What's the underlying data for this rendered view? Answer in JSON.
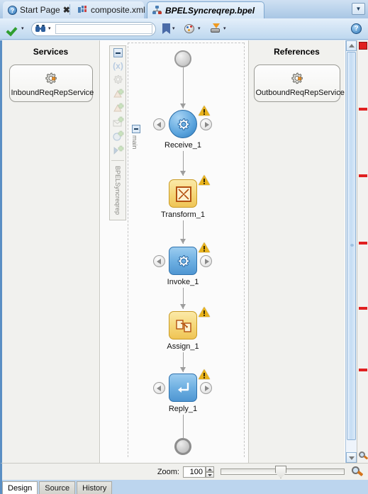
{
  "window": {
    "tabs": [
      {
        "label": "Start Page",
        "icon": "help-circle-icon",
        "active": false,
        "closable": true
      },
      {
        "label": "composite.xml",
        "icon": "composite-icon",
        "active": false,
        "closable": false
      },
      {
        "label": "BPELSyncreqrep.bpel",
        "icon": "bpel-icon",
        "active": true,
        "closable": false
      }
    ],
    "tab_overflow_label": "▼"
  },
  "toolbar": {
    "validate_label": "",
    "search_value": "",
    "search_placeholder": "",
    "bookmark_label": "",
    "palette_label": "",
    "deploy_label": "",
    "help_label": "?",
    "dropdown_caret": "▾"
  },
  "services_panel": {
    "title": "Services",
    "nodes": [
      {
        "label": "InboundReqRepService",
        "icon": "gear-icon"
      }
    ]
  },
  "references_panel": {
    "title": "References",
    "nodes": [
      {
        "label": "OutboundReqRepService",
        "icon": "gear-icon"
      }
    ]
  },
  "canvas": {
    "scope_label": "main",
    "palette_label": "BPELSyncreqrep",
    "palette_icons": [
      "variables-x-icon",
      "gear-icon",
      "partnerlink-add-icon",
      "partnerlink-add-2-icon",
      "message-add-icon",
      "scope-add-icon",
      "flag-add-icon"
    ],
    "start_node": {
      "name": "start-event"
    },
    "end_node": {
      "name": "end-event"
    },
    "nodes": [
      {
        "label": "Receive_1",
        "shape": "circle",
        "glyph": "gear-icon",
        "warning": true,
        "nav": true
      },
      {
        "label": "Transform_1",
        "shape": "sq-yellow",
        "glyph": "transform-icon",
        "warning": true,
        "nav": false
      },
      {
        "label": "Invoke_1",
        "shape": "sq-blue",
        "glyph": "gear-icon",
        "warning": true,
        "nav": true
      },
      {
        "label": "Assign_1",
        "shape": "sq-yellow",
        "glyph": "assign-icon",
        "warning": true,
        "nav": false
      },
      {
        "label": "Reply_1",
        "shape": "sq-blue",
        "glyph": "reply-icon",
        "warning": true,
        "nav": true
      }
    ]
  },
  "zoombar": {
    "label": "Zoom:",
    "value": "100",
    "slider_position_percent": 44
  },
  "bottom_tabs": [
    {
      "label": "Design",
      "active": true
    },
    {
      "label": "Source",
      "active": false
    },
    {
      "label": "History",
      "active": false
    }
  ],
  "colors": {
    "accent": "#5a8fc4",
    "warning": "#e8b21c",
    "error_marker": "#e02020",
    "node_blue": "#5ba4dd",
    "node_yellow": "#f6d87a"
  }
}
